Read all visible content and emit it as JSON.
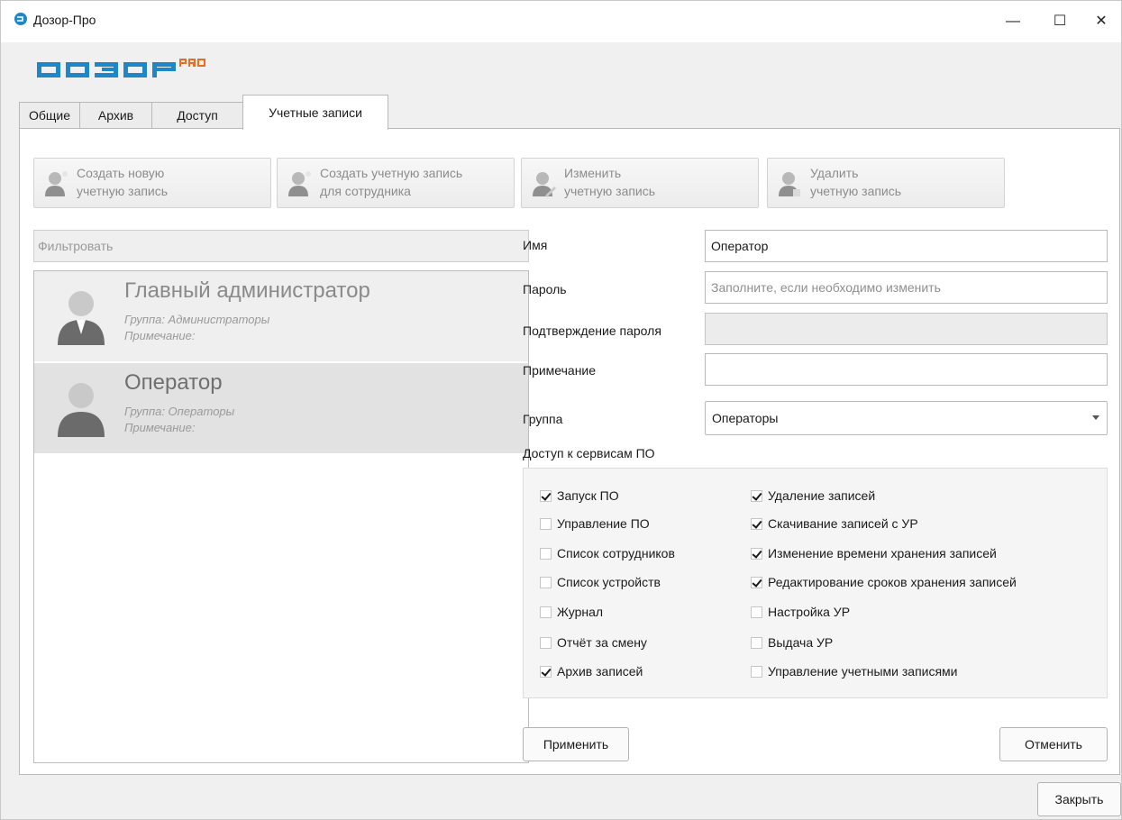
{
  "window": {
    "title": "Дозор-Про",
    "minimize": "—",
    "maximize": "☐",
    "close": "✕",
    "accent": "#1d87c7",
    "logo_orange": "#f06a1f"
  },
  "tabs": [
    {
      "label": "Общие"
    },
    {
      "label": "Архив"
    },
    {
      "label": "Доступ"
    },
    {
      "label": "Учетные записи",
      "active": true
    }
  ],
  "toolbar": {
    "create": "Создать новую\nучетную запись",
    "create_for_employee": "Создать учетную запись\nдля сотрудника",
    "edit": "Изменить\nучетную запись",
    "delete": "Удалить\nучетную запись"
  },
  "filter": {
    "placeholder": "Фильтровать"
  },
  "users": [
    {
      "name": "Главный администратор",
      "group": "Группа: Администраторы",
      "note": "Примечание:"
    },
    {
      "name": "Оператор",
      "group": "Группа: Операторы",
      "note": "Примечание:"
    }
  ],
  "form": {
    "name_label": "Имя",
    "name_value": "Оператор",
    "password_label": "Пароль",
    "password_placeholder": "Заполните, если необходимо изменить",
    "confirm_label": "Подтверждение пароля",
    "note_label": "Примечание",
    "note_value": "",
    "group_label": "Группа",
    "group_value": "Операторы"
  },
  "access": {
    "title": "Доступ к сервисам ПО",
    "left": [
      {
        "label": "Запуск ПО",
        "checked": true
      },
      {
        "label": "Управление ПО",
        "checked": false
      },
      {
        "label": "Список сотрудников",
        "checked": false
      },
      {
        "label": "Список устройств",
        "checked": false
      },
      {
        "label": "Журнал",
        "checked": false
      },
      {
        "label": "Отчёт за смену",
        "checked": false
      },
      {
        "label": "Архив записей",
        "checked": true
      }
    ],
    "right": [
      {
        "label": "Удаление записей",
        "checked": true
      },
      {
        "label": "Скачивание записей с УР",
        "checked": true
      },
      {
        "label": "Изменение времени хранения записей",
        "checked": true
      },
      {
        "label": "Редактирование сроков хранения записей",
        "checked": true
      },
      {
        "label": "Настройка УР",
        "checked": false
      },
      {
        "label": "Выдача УР",
        "checked": false
      },
      {
        "label": "Управление учетными записями",
        "checked": false
      }
    ]
  },
  "buttons": {
    "apply": "Применить",
    "cancel": "Отменить",
    "close": "Закрыть"
  }
}
